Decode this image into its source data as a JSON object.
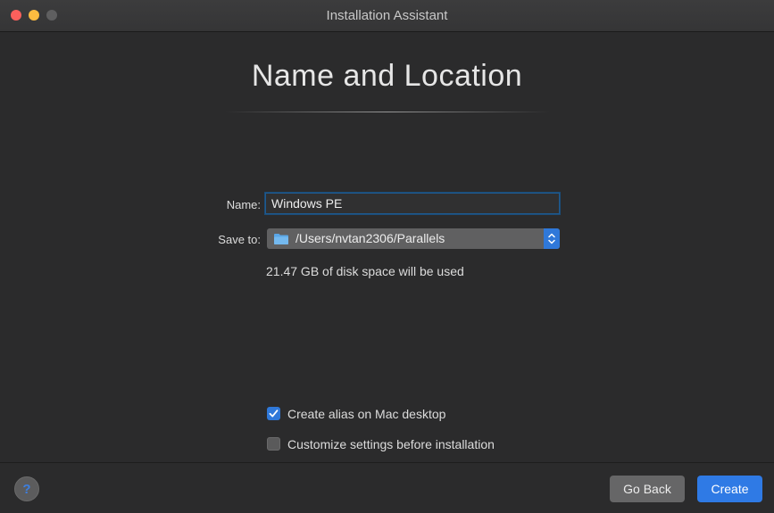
{
  "window": {
    "title": "Installation Assistant"
  },
  "page": {
    "heading": "Name and Location"
  },
  "form": {
    "name_label": "Name:",
    "name_value": "Windows PE",
    "save_label": "Save to:",
    "save_path": "/Users/nvtan2306/Parallels",
    "disk_info": "21.47 GB of disk space will be used"
  },
  "options": [
    {
      "label": "Create alias on Mac desktop",
      "checked": true
    },
    {
      "label": "Customize settings before installation",
      "checked": false
    }
  ],
  "footer": {
    "help_label": "?",
    "back_label": "Go Back",
    "create_label": "Create"
  },
  "colors": {
    "accent": "#2f7ae5",
    "background": "#2b2b2c",
    "close": "#fc605c",
    "minimize": "#fdbc40"
  },
  "icons": {
    "folder": "folder-icon",
    "popup": "up-down-chevron-icon",
    "check": "checkmark-icon"
  }
}
